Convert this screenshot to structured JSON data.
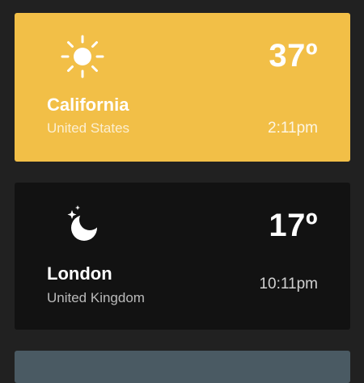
{
  "cards": [
    {
      "temperature": "37º",
      "city": "California",
      "country": "United States",
      "time": "2:11pm",
      "icon": "sun-icon",
      "color": "#F2BF47"
    },
    {
      "temperature": "17º",
      "city": "London",
      "country": "United Kingdom",
      "time": "10:11pm",
      "icon": "moon-stars-icon",
      "color": "#121212"
    },
    {
      "color": "#4A5A63"
    }
  ]
}
